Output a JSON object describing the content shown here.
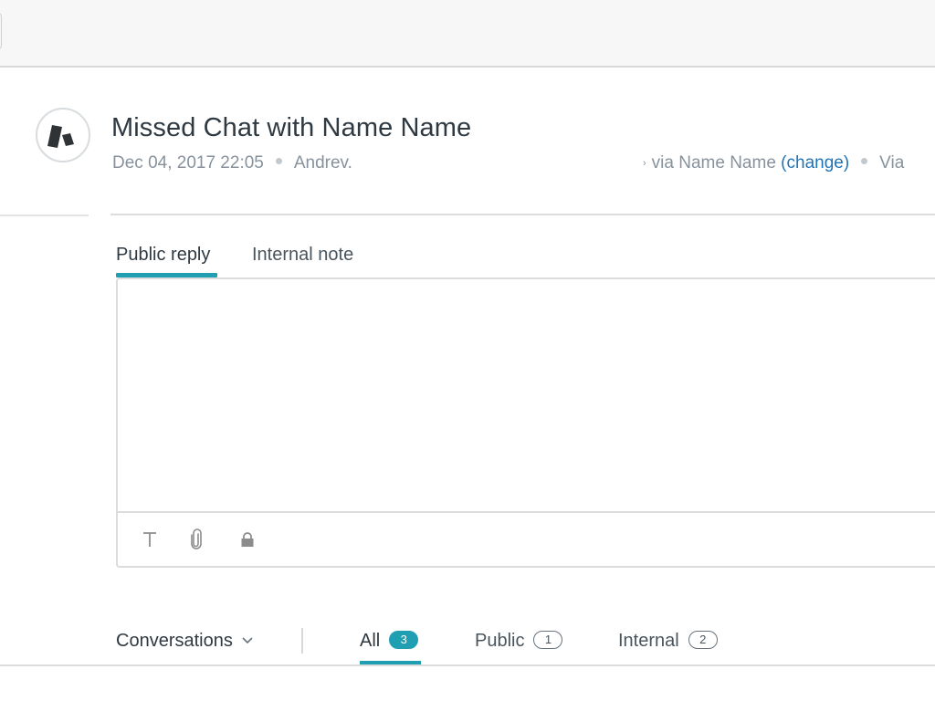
{
  "ticket": {
    "title": "Missed Chat with Name Name",
    "date": "Dec 04, 2017 22:05",
    "requester": "Andrev.",
    "via_prefix": "via Name Name",
    "change_link": "(change)",
    "channel": "Via"
  },
  "composer": {
    "tabs": [
      {
        "label": "Public reply",
        "active": true
      },
      {
        "label": "Internal note",
        "active": false
      }
    ],
    "body_value": "",
    "toolbar": [
      {
        "icon": "text-format-icon",
        "glyph": "T"
      },
      {
        "icon": "attachment-icon"
      },
      {
        "icon": "lock-icon"
      }
    ]
  },
  "conversations": {
    "dropdown_label": "Conversations",
    "filters": [
      {
        "label": "All",
        "count": "3",
        "active": true
      },
      {
        "label": "Public",
        "count": "1",
        "active": false
      },
      {
        "label": "Internal",
        "count": "2",
        "active": false
      }
    ]
  },
  "colors": {
    "accent": "#1f9fb1",
    "link": "#1f73b7",
    "muted_text": "#87929d"
  }
}
